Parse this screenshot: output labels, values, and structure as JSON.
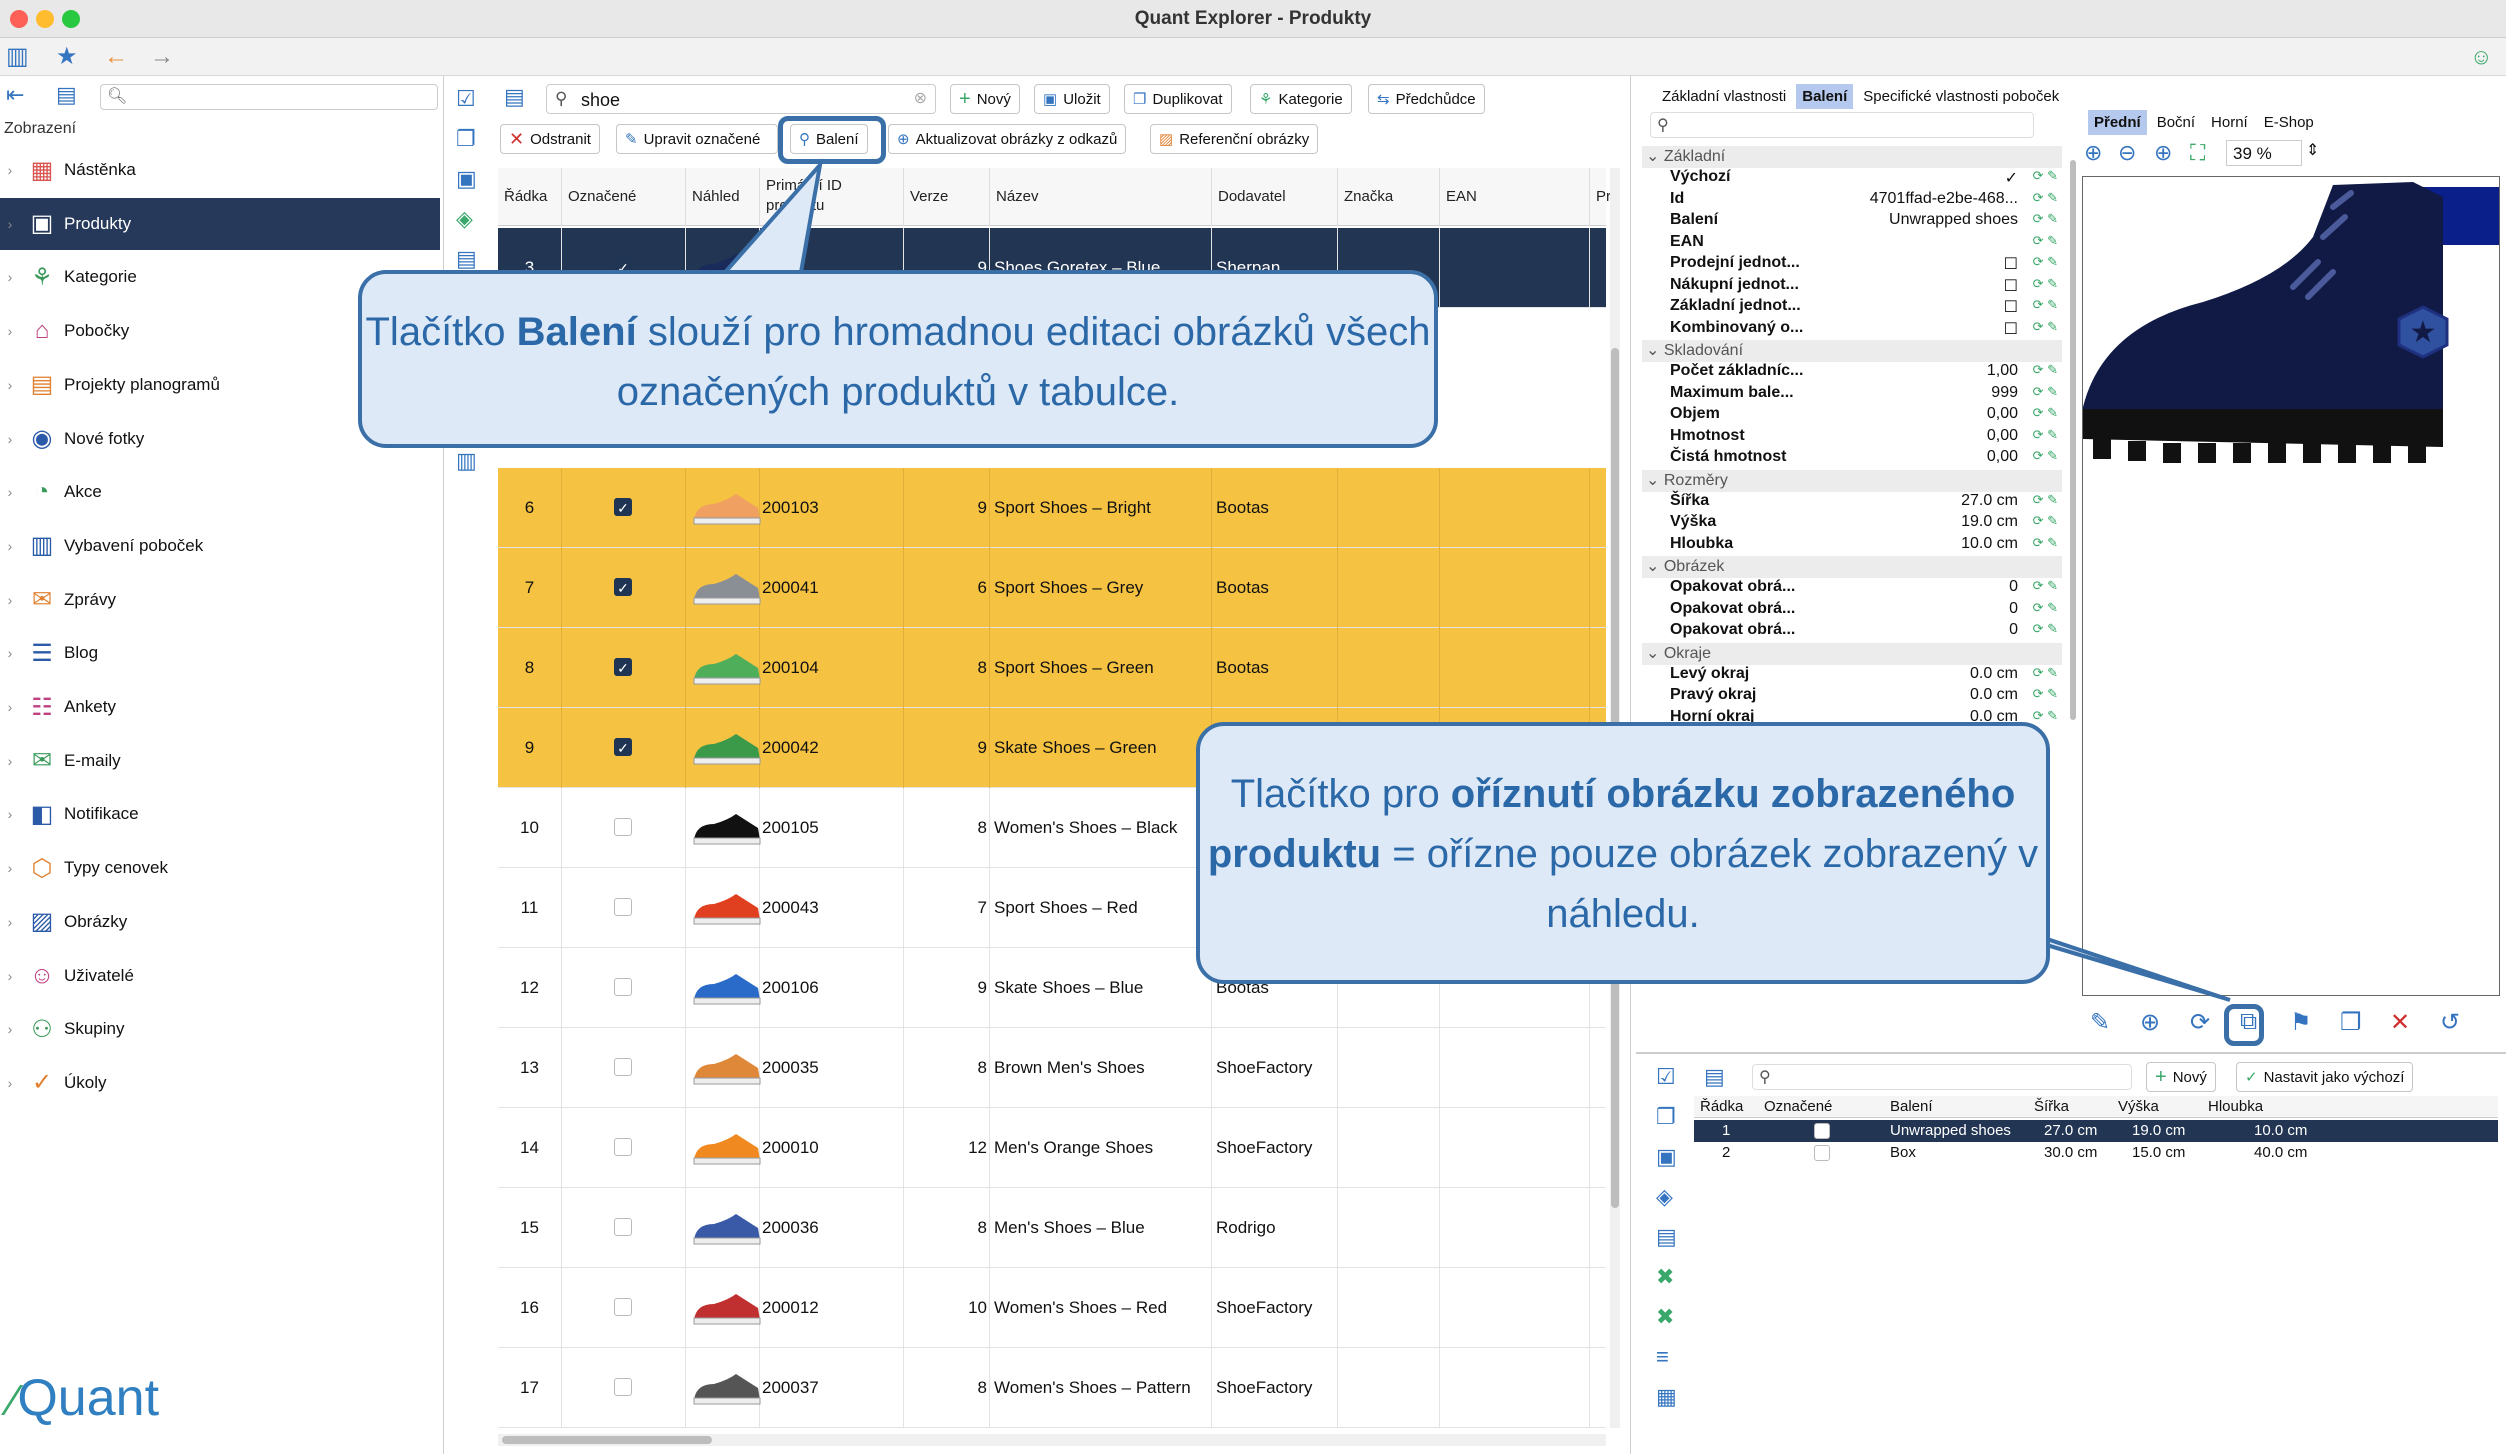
{
  "window": {
    "title": "Quant Explorer - Produkty"
  },
  "sidebar": {
    "header": "Zobrazení",
    "items": [
      {
        "label": "Nástěnka",
        "icon": "dashboard-icon",
        "glyph": "▦",
        "color": "#d9534f"
      },
      {
        "label": "Produkty",
        "icon": "products-icon",
        "glyph": "▣",
        "color": "#ffffff"
      },
      {
        "label": "Kategorie",
        "icon": "categories-icon",
        "glyph": "⚘",
        "color": "#3a9a5a"
      },
      {
        "label": "Pobočky",
        "icon": "branches-icon",
        "glyph": "⌂",
        "color": "#c04080"
      },
      {
        "label": "Projekty planogramů",
        "icon": "planogram-icon",
        "glyph": "▤",
        "color": "#e08030"
      },
      {
        "label": "Nové fotky",
        "icon": "camera-icon",
        "glyph": "◉",
        "color": "#2a5aa8"
      },
      {
        "label": "Akce",
        "icon": "promo-icon",
        "glyph": "◔",
        "color": "#3a9a5a"
      },
      {
        "label": "Vybavení poboček",
        "icon": "equipment-icon",
        "glyph": "▥",
        "color": "#2a5aa8"
      },
      {
        "label": "Zprávy",
        "icon": "messages-icon",
        "glyph": "✉",
        "color": "#e08030"
      },
      {
        "label": "Blog",
        "icon": "blog-icon",
        "glyph": "☰",
        "color": "#2a5aa8"
      },
      {
        "label": "Ankety",
        "icon": "poll-icon",
        "glyph": "☷",
        "color": "#c04080"
      },
      {
        "label": "E-maily",
        "icon": "email-icon",
        "glyph": "✉",
        "color": "#3a9a5a"
      },
      {
        "label": "Notifikace",
        "icon": "notification-icon",
        "glyph": "◧",
        "color": "#2a5aa8"
      },
      {
        "label": "Typy cenovek",
        "icon": "price-tag-icon",
        "glyph": "⬡",
        "color": "#e08030"
      },
      {
        "label": "Obrázky",
        "icon": "image-icon",
        "glyph": "▨",
        "color": "#2a5aa8"
      },
      {
        "label": "Uživatelé",
        "icon": "user-icon",
        "glyph": "☺",
        "color": "#c04080"
      },
      {
        "label": "Skupiny",
        "icon": "group-icon",
        "glyph": "⚇",
        "color": "#3a9a5a"
      },
      {
        "label": "Úkoly",
        "icon": "task-icon",
        "glyph": "✓",
        "color": "#e08030"
      }
    ],
    "logo": "Quant"
  },
  "toolbar": {
    "search_value": "shoe",
    "new": "Nový",
    "save": "Uložit",
    "duplicate": "Duplikovat",
    "categories": "Kategorie",
    "predecessors": "Předchůdce",
    "remove": "Odstranit",
    "edit_marked": "Upravit označené",
    "packaging": "Balení",
    "update_images": "Aktualizovat obrázky z odkazů",
    "reference_images": "Referenční obrázky"
  },
  "grid": {
    "columns": [
      "Řádka",
      "Označené",
      "Náhled",
      "Primární ID produktu",
      "Verze",
      "Název",
      "Dodavatel",
      "Značka",
      "EAN",
      "Pr"
    ],
    "rows": [
      {
        "row": "3",
        "checked": true,
        "id": "200...",
        "ver": "9",
        "name": "Shoes Goretex – Blue",
        "supplier": "Sherpan",
        "style": "sel",
        "shoe": "#1a2a5a"
      },
      {
        "row": "6",
        "checked": true,
        "id": "200103",
        "ver": "9",
        "name": "Sport Shoes – Bright",
        "supplier": "Bootas",
        "style": "y",
        "shoe": "#f0a060"
      },
      {
        "row": "7",
        "checked": true,
        "id": "200041",
        "ver": "6",
        "name": "Sport Shoes – Grey",
        "supplier": "Bootas",
        "style": "y",
        "shoe": "#8a8f96"
      },
      {
        "row": "8",
        "checked": true,
        "id": "200104",
        "ver": "8",
        "name": "Sport Shoes – Green",
        "supplier": "Bootas",
        "style": "y",
        "shoe": "#4fae5a"
      },
      {
        "row": "9",
        "checked": true,
        "id": "200042",
        "ver": "9",
        "name": "Skate Shoes – Green",
        "supplier": "",
        "style": "y",
        "shoe": "#3a9a4a"
      },
      {
        "row": "10",
        "checked": false,
        "id": "200105",
        "ver": "8",
        "name": "Women's Shoes – Black",
        "supplier": "",
        "style": "",
        "shoe": "#111111"
      },
      {
        "row": "11",
        "checked": false,
        "id": "200043",
        "ver": "7",
        "name": "Sport Shoes – Red",
        "supplier": "",
        "style": "",
        "shoe": "#e04020"
      },
      {
        "row": "12",
        "checked": false,
        "id": "200106",
        "ver": "9",
        "name": "Skate Shoes – Blue",
        "supplier": "Bootas",
        "style": "",
        "shoe": "#2a6ac8"
      },
      {
        "row": "13",
        "checked": false,
        "id": "200035",
        "ver": "8",
        "name": "Brown Men's Shoes",
        "supplier": "ShoeFactory",
        "style": "",
        "shoe": "#e0883a"
      },
      {
        "row": "14",
        "checked": false,
        "id": "200010",
        "ver": "12",
        "name": "Men's Orange Shoes",
        "supplier": "ShoeFactory",
        "style": "",
        "shoe": "#f08a20"
      },
      {
        "row": "15",
        "checked": false,
        "id": "200036",
        "ver": "8",
        "name": "Men's Shoes – Blue",
        "supplier": "Rodrigo",
        "style": "",
        "shoe": "#3a5aa8"
      },
      {
        "row": "16",
        "checked": false,
        "id": "200012",
        "ver": "10",
        "name": "Women's Shoes – Red",
        "supplier": "ShoeFactory",
        "style": "",
        "shoe": "#c03030"
      },
      {
        "row": "17",
        "checked": false,
        "id": "200037",
        "ver": "8",
        "name": "Women's Shoes – Pattern",
        "supplier": "ShoeFactory",
        "style": "",
        "shoe": "#555555"
      }
    ]
  },
  "right": {
    "tabs": [
      "Základní vlastnosti",
      "Balení",
      "Specifické vlastnosti poboček"
    ],
    "view_tabs": [
      "Přední",
      "Boční",
      "Horní",
      "E-Shop"
    ],
    "zoom": "39 %",
    "sections": [
      {
        "title": "Základní",
        "rows": [
          {
            "k": "Výchozí",
            "v": "✓"
          },
          {
            "k": "Id",
            "v": "4701ffad-e2be-468..."
          },
          {
            "k": "Balení",
            "v": "Unwrapped shoes"
          },
          {
            "k": "EAN",
            "v": ""
          },
          {
            "k": "Prodejní jednot...",
            "v": "☐"
          },
          {
            "k": "Nákupní jednot...",
            "v": "☐"
          },
          {
            "k": "Základní jednot...",
            "v": "☐"
          },
          {
            "k": "Kombinovaný o...",
            "v": "☐"
          }
        ]
      },
      {
        "title": "Skladování",
        "rows": [
          {
            "k": "Počet základníc...",
            "v": "1,00"
          },
          {
            "k": "Maximum bale...",
            "v": "999"
          },
          {
            "k": "Objem",
            "v": "0,00"
          },
          {
            "k": "Hmotnost",
            "v": "0,00"
          },
          {
            "k": "Čistá hmotnost",
            "v": "0,00"
          }
        ]
      },
      {
        "title": "Rozměry",
        "rows": [
          {
            "k": "Šířka",
            "v": "27.0 cm"
          },
          {
            "k": "Výška",
            "v": "19.0 cm"
          },
          {
            "k": "Hloubka",
            "v": "10.0 cm"
          }
        ]
      },
      {
        "title": "Obrázek",
        "rows": [
          {
            "k": "Opakovat obrá...",
            "v": "0"
          },
          {
            "k": "Opakovat obrá...",
            "v": "0"
          },
          {
            "k": "Opakovat obrá...",
            "v": "0"
          }
        ]
      },
      {
        "title": "Okraje",
        "rows": [
          {
            "k": "Levý okraj",
            "v": "0.0 cm"
          },
          {
            "k": "Pravý okraj",
            "v": "0.0 cm"
          },
          {
            "k": "Horní okraj",
            "v": "0.0 cm"
          }
        ]
      }
    ],
    "sub": {
      "new": "Nový",
      "set_default": "Nastavit jako výchozí",
      "columns": [
        "Řádka",
        "Označené",
        "Balení",
        "Šířka",
        "Výška",
        "Hloubka"
      ],
      "rows": [
        {
          "row": "1",
          "pkg": "Unwrapped shoes",
          "w": "27.0 cm",
          "h": "19.0 cm",
          "d": "10.0 cm"
        },
        {
          "row": "2",
          "pkg": "Box",
          "w": "30.0 cm",
          "h": "15.0 cm",
          "d": "40.0 cm"
        }
      ]
    }
  },
  "callouts": {
    "top": {
      "pre": "Tlačítko ",
      "bold": "Balení",
      "post": " slouží pro hromadnou editaci obrázků všech označených produktů v tabulce."
    },
    "bottom": {
      "pre": "Tlačítko pro ",
      "bold": "oříznutí obrázku zobrazeného produktu",
      "post": " = ořízne pouze obrázek zobrazený v náhledu."
    }
  }
}
